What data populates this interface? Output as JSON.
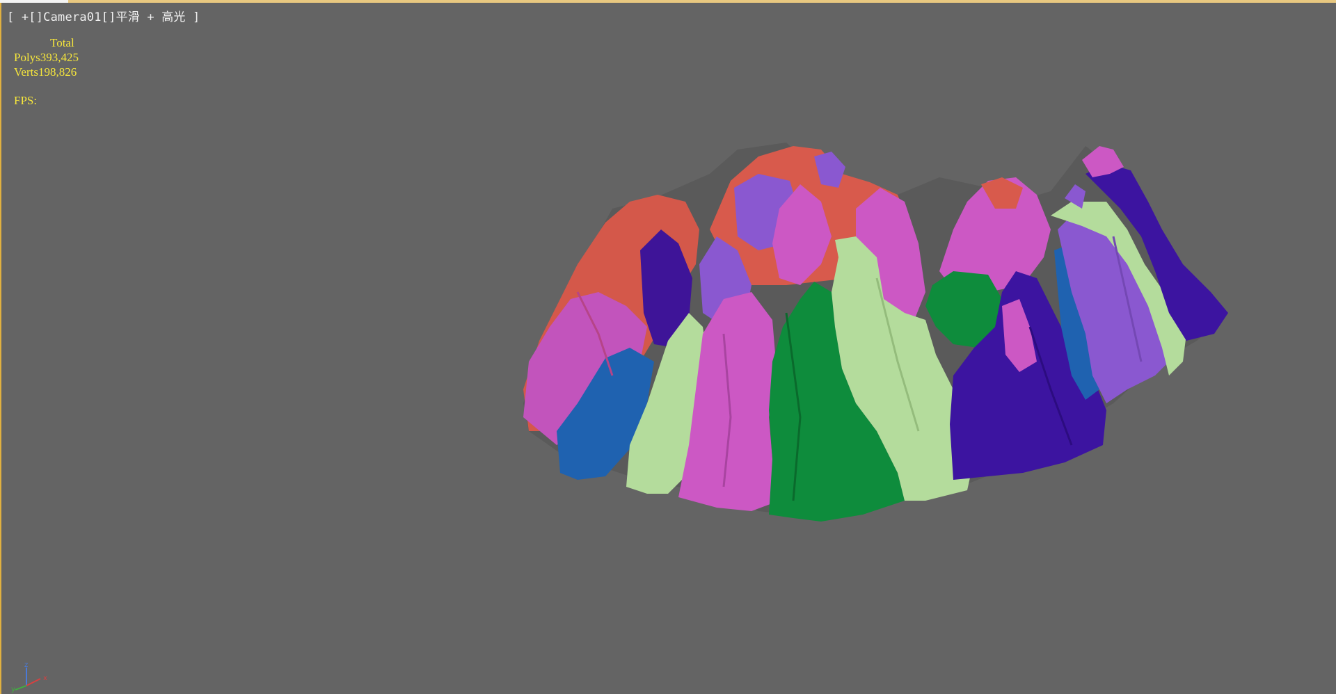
{
  "viewport": {
    "label": "[ +[]Camera01[]平滑 + 高光 ]",
    "background_color": "#646464",
    "active_border_color": "#e0b040"
  },
  "stats": {
    "header": "Total",
    "polys_label": "Polys",
    "polys_value": "393,425",
    "verts_label": "Verts",
    "verts_value": "198,826",
    "fps_label": "FPS:",
    "text_color": "#f6e63c"
  },
  "gizmo": {
    "z_label": "z",
    "x_label": "x",
    "y_label": "y"
  },
  "model": {
    "icon": "rock-mountain-model",
    "colors": {
      "red": "#d85a4c",
      "pink": "#cc58c4",
      "purple": "#8a58d0",
      "indigo": "#3c14a0",
      "blue": "#1e64b4",
      "light_green": "#b4dc9c",
      "green": "#0e8c3c"
    }
  }
}
